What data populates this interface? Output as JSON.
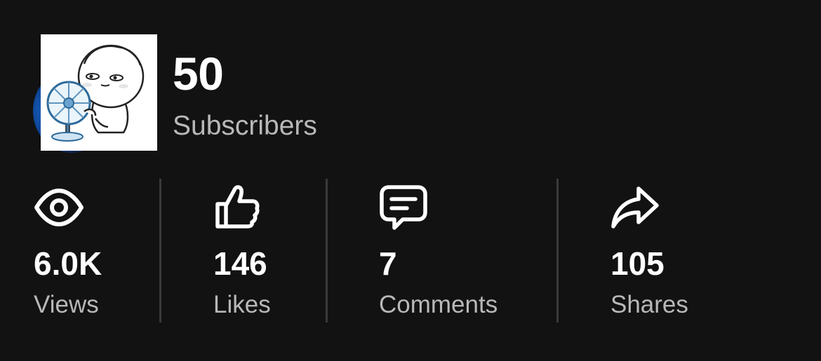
{
  "colors": {
    "background": "#121212",
    "primary_text": "#ffffff",
    "secondary_text": "#b8b8b8",
    "divider": "#3a3a3a"
  },
  "header": {
    "avatar_icon": "profile-avatar-sticker",
    "subscriber_count": "50",
    "subscriber_label": "Subscribers"
  },
  "stats": [
    {
      "icon": "eye-icon",
      "value": "6.0K",
      "label": "Views"
    },
    {
      "icon": "thumbs-up-icon",
      "value": "146",
      "label": "Likes"
    },
    {
      "icon": "comment-icon",
      "value": "7",
      "label": "Comments"
    },
    {
      "icon": "share-arrow-icon",
      "value": "105",
      "label": "Shares"
    }
  ]
}
